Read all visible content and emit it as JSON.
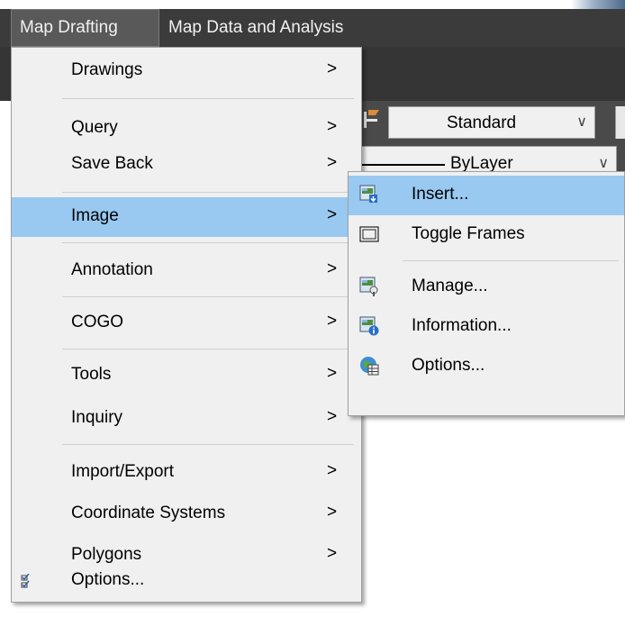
{
  "menubar": {
    "items": [
      "Map Drafting",
      "Map Data and Analysis"
    ]
  },
  "toolbar": {
    "style_combo_value": "Standard",
    "layer_combo_value": "ByLayer"
  },
  "main_menu": {
    "items": [
      {
        "label": "Drawings",
        "submenu": true
      },
      {
        "label": "Query",
        "submenu": true
      },
      {
        "label": "Save Back",
        "submenu": true
      },
      {
        "label": "Image",
        "submenu": true,
        "active": true
      },
      {
        "label": "Annotation",
        "submenu": true
      },
      {
        "label": "COGO",
        "submenu": true
      },
      {
        "label": "Tools",
        "submenu": true
      },
      {
        "label": "Inquiry",
        "submenu": true
      },
      {
        "label": "Import/Export",
        "submenu": true
      },
      {
        "label": "Coordinate Systems",
        "submenu": true
      },
      {
        "label": "Polygons",
        "submenu": true
      },
      {
        "label": "Options...",
        "icon": "checklist-icon"
      }
    ],
    "arrow_glyph": ">"
  },
  "image_submenu": {
    "items": [
      {
        "label": "Insert...",
        "icon": "insert-image-icon",
        "active": true
      },
      {
        "label": "Toggle Frames",
        "icon": "frame-icon"
      },
      {
        "label": "Manage...",
        "icon": "manage-image-icon"
      },
      {
        "label": "Information...",
        "icon": "image-info-icon"
      },
      {
        "label": "Options...",
        "icon": "globe-options-icon"
      }
    ]
  },
  "colors": {
    "menubar_bg": "#3b3b3b",
    "menu_bg": "#f0f0f0",
    "highlight": "#99c9f1"
  }
}
